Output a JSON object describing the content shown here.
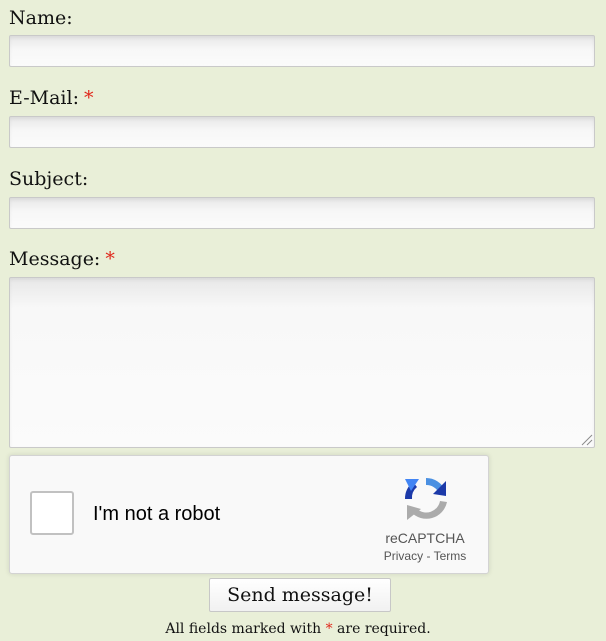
{
  "form": {
    "fields": {
      "name": {
        "label": "Name:",
        "value": "",
        "required": false
      },
      "email": {
        "label": "E-Mail:",
        "value": "",
        "required": true
      },
      "subject": {
        "label": "Subject:",
        "value": "",
        "required": false
      },
      "message": {
        "label": "Message:",
        "value": "",
        "required": true
      }
    },
    "required_marker": "*",
    "submit_label": "Send message!",
    "footnote_before": "All fields marked with",
    "footnote_after": "are required."
  },
  "recaptcha": {
    "checkbox_label": "I'm not a robot",
    "brand": "reCAPTCHA",
    "privacy_label": "Privacy",
    "separator": "-",
    "terms_label": "Terms",
    "checked": false
  },
  "colors": {
    "page_background": "#e9efd8",
    "required_marker": "#e0261a"
  }
}
